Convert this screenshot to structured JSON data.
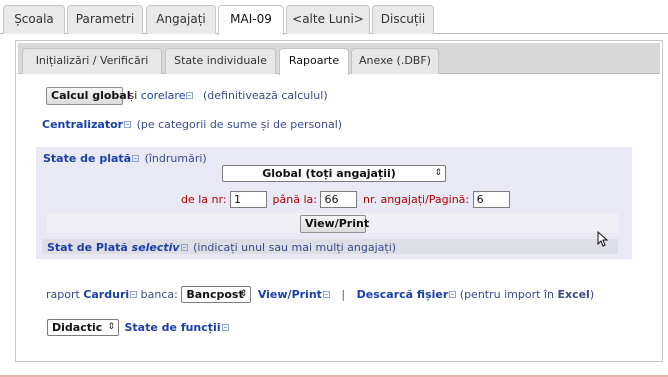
{
  "top_tabs": [
    "Școala",
    "Parametri",
    "Angajați",
    "MAI-09",
    "<alte Luni>",
    "Discuții"
  ],
  "sub_tabs": [
    "Inițializări / Verificări",
    "State individuale",
    "Rapoarte",
    "Anexe (.DBF)"
  ],
  "calcul": {
    "button": "Calcul global",
    "and": "și",
    "corelare": "corelare",
    "note": "(definitivează calculul)"
  },
  "centralizator": {
    "label": "Centralizator",
    "note": "(pe categorii de sume și de personal)"
  },
  "state_plata": {
    "label": "State de plată",
    "note": "(îndrumări)",
    "select_value": "Global (toți angajații)",
    "from_label": "de la nr:",
    "from_value": "1",
    "to_label": "până la:",
    "to_value": "66",
    "per_page_label": "nr. angajați/Pagină:",
    "per_page_value": "6",
    "view_button": "View/Print",
    "selectiv_label": "Stat de Plată",
    "selectiv_word": "selectiv",
    "selectiv_note": "(indicați unul sau mai mulți angajați)"
  },
  "carduri": {
    "prefix": "raport",
    "label": "Carduri",
    "bank_label": "banca:",
    "bank_value": "Bancpost",
    "view_link": "View/Print",
    "separator": "|",
    "download_link": "Descarcă fișier",
    "download_note_prefix": "(pentru import în",
    "download_note_app": "Excel",
    "download_note_suffix": ")"
  },
  "functii": {
    "select_value": "Didactic",
    "label": "State de funcții"
  },
  "colors": {
    "link": "#1a3fa8",
    "section_bg": "#e9e9f6",
    "red_label": "#b30000"
  }
}
